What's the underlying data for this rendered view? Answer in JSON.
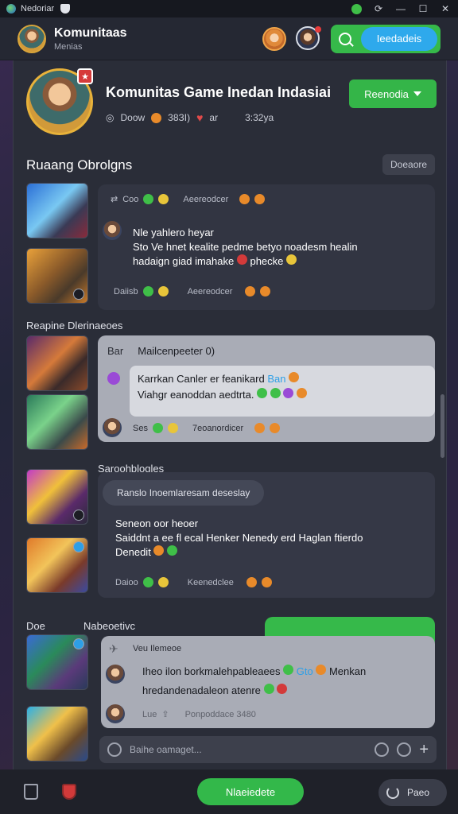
{
  "window": {
    "title": "Nedoriar",
    "controls": [
      "minimize",
      "maximize",
      "close"
    ]
  },
  "header": {
    "title": "Komunitaas",
    "subtitle": "Menias",
    "join_label": "Ieedadeis"
  },
  "hero": {
    "title": "Komunitas Game Inedan Indasiai",
    "members": "Doow",
    "online": "38ЗI)",
    "status": "ar",
    "time": "3:32ya",
    "action_label": "Reenodia"
  },
  "section_main": {
    "title": "Ruaang Obrolgns",
    "button_label": "Doeaore"
  },
  "post1": {
    "author": "Coo",
    "meta": "Aeereodcer",
    "heading": "Nle yahlero heyar",
    "line1": "Sto Ve hnet kealite pedme betyo noadesm healin",
    "line2": "hadaign giad imahake",
    "line2_tail": "phecke",
    "footer_name": "Daiisb",
    "footer_meta": "Aeereodcer"
  },
  "section_second": {
    "label": "Reapine Dlerinaeoes"
  },
  "post2": {
    "author": "Bar",
    "heading": "Mailcenpeeter 0)",
    "line1": "Karrkan Canler er feanikard",
    "line1_hl": "Ban",
    "line2": "Viahgr eanoddan aedtrta.",
    "footer_name": "Ses",
    "footer_meta": "7eoanordicer"
  },
  "section_third": {
    "label": "Saroohblogles"
  },
  "post3": {
    "tag": "Ranslo Inoemlaresam deseslay",
    "heading": "Seneon oor heoer",
    "line1": "Saiddnt a ee fl ecal Henker Nenedy erd Haglan ftierdo",
    "line2": "Denedit",
    "footer_name": "Daioo",
    "footer_meta": "Keenedclee"
  },
  "section_fourth": {
    "label_left": "Doe",
    "label_right": "Nabeoetivc"
  },
  "post4": {
    "heading": "Veu Ilemeoe",
    "line1": "Iheo ilon borkmalehpableaees",
    "line1_hl": "Gto",
    "line1_tail": "Menkan",
    "line2": "hredandenadaleon atenre",
    "footer_name": "Lue",
    "footer_meta": "Ponpoddace 3480"
  },
  "composer": {
    "placeholder": "Baihe oamaget..."
  },
  "bottom": {
    "main_label": "Nlaeiedete",
    "right_label": "Paeo"
  },
  "colors": {
    "accent_green": "#36b94a",
    "accent_blue": "#2ea9ec",
    "panel": "#2a2d38",
    "danger": "#d23a3a"
  }
}
